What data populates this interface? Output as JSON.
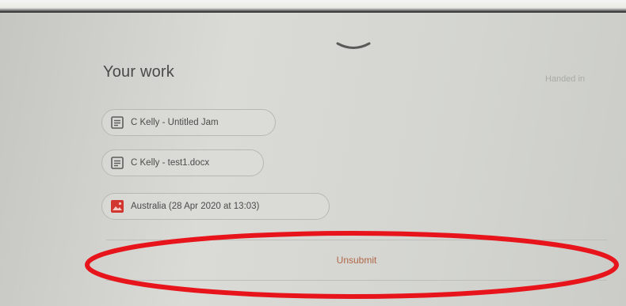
{
  "header": {
    "collapse_icon": "chevron-down-icon"
  },
  "your_work": {
    "title": "Your work",
    "status": "Handed in",
    "attachments": [
      {
        "label": "C Kelly - Untitled Jam",
        "icon": "document-icon"
      },
      {
        "label": "C Kelly - test1.docx",
        "icon": "document-icon"
      },
      {
        "label": "Australia (28 Apr 2020 at 13:03)",
        "icon": "image-icon"
      }
    ],
    "unsubmit_label": "Unsubmit"
  },
  "colors": {
    "annotation_red": "#e8141b",
    "unsubmit_text": "#b06747",
    "image_icon": "#d2342e",
    "document_icon": "#5c5d5a"
  }
}
